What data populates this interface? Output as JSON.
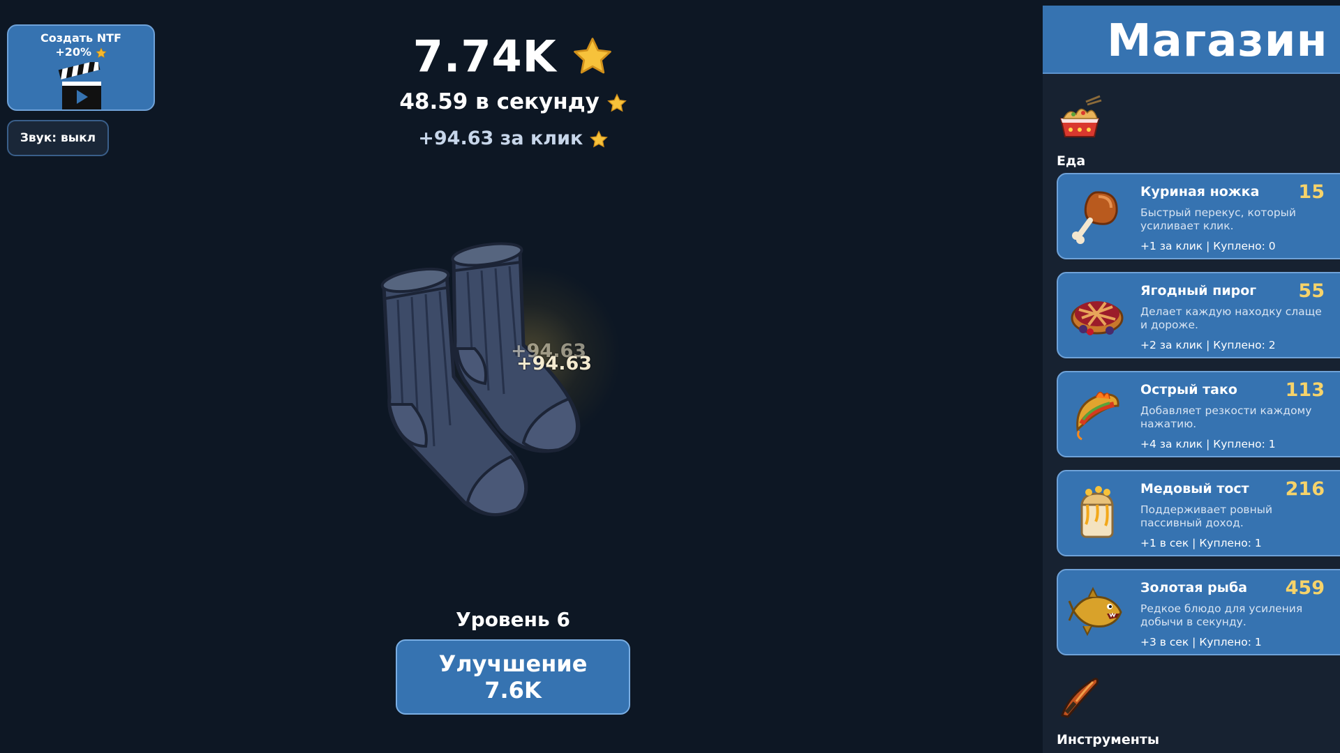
{
  "ntf_button": {
    "line1": "Создать NTF",
    "line2": "+20%"
  },
  "sound_button": {
    "label": "Звук: выкл"
  },
  "stats": {
    "total": "7.74K",
    "per_second": "48.59 в секунду",
    "per_click": "+94.63 за клик"
  },
  "floating": [
    "+94.63",
    "+94.63"
  ],
  "level": {
    "label": "Уровень 6"
  },
  "upgrade": {
    "label": "Улучшение",
    "cost": "7.6K"
  },
  "shop": {
    "title": "Магазин",
    "categories": [
      {
        "label": "Еда",
        "icon": "noodle-box-icon"
      },
      {
        "label": "Инструменты",
        "icon": "tool-icon"
      }
    ],
    "items": [
      {
        "name": "Куриная ножка",
        "price": "15",
        "desc": "Быстрый перекус, который усиливает клик.",
        "stats": "+1 за клик | Куплено: 0",
        "icon": "chicken-leg-icon"
      },
      {
        "name": "Ягодный пирог",
        "price": "55",
        "desc": "Делает каждую находку слаще и дороже.",
        "stats": "+2 за клик | Куплено: 2",
        "icon": "berry-pie-icon"
      },
      {
        "name": "Острый тако",
        "price": "113",
        "desc": "Добавляет резкости каждому нажатию.",
        "stats": "+4 за клик | Куплено: 1",
        "icon": "taco-icon"
      },
      {
        "name": "Медовый тост",
        "price": "216",
        "desc": "Поддерживает ровный пассивный доход.",
        "stats": "+1 в сек | Куплено: 1",
        "icon": "honey-toast-icon"
      },
      {
        "name": "Золотая рыба",
        "price": "459",
        "desc": "Редкое блюдо для усиления добычи в секунду.",
        "stats": "+3 в сек | Куплено: 1",
        "icon": "golden-fish-icon"
      }
    ]
  },
  "colors": {
    "background": "#0d1724",
    "accent": "#3673b1",
    "price": "#f6d36a",
    "star": "#f5b82e"
  }
}
